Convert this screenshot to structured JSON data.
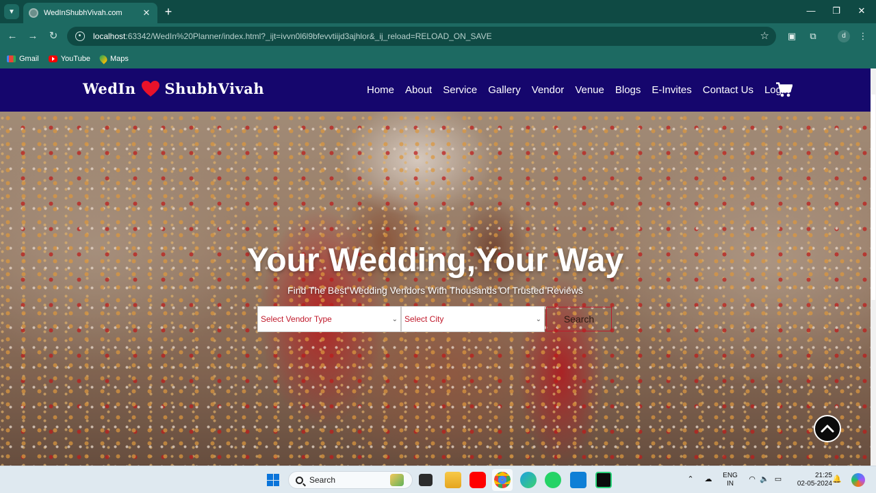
{
  "browser": {
    "tab": {
      "title": "WedInShubhVivah.com"
    },
    "url": {
      "host": "localhost",
      "rest": ":63342/WedIn%20Planner/index.html?_ijt=ivvn0l6l9bfevvtiijd3ajhlor&_ij_reload=RELOAD_ON_SAVE"
    },
    "profile_initial": "d",
    "bookmarks": [
      "Gmail",
      "YouTube",
      "Maps"
    ]
  },
  "site": {
    "logo_left": "WedIn",
    "logo_right": "ShubhVivah",
    "nav": [
      "Home",
      "About",
      "Service",
      "Gallery",
      "Vendor",
      "Venue",
      "Blogs",
      "E-Invites",
      "Contact Us",
      "Login"
    ],
    "hero": {
      "title": "Your Wedding,Your Way",
      "subtitle": "Find The Best Wedding Vendors With Thousands Of Trusted Reviews"
    },
    "search": {
      "vendor_type": "Select Vendor Type",
      "city": "Select City",
      "button": "Search"
    }
  },
  "taskbar": {
    "search_label": "Search",
    "language": "ENG",
    "region": "IN",
    "time": "21:25",
    "date": "02-05-2024"
  },
  "colors": {
    "nav_background": "#15066d",
    "heart": "#e8122a",
    "select_text": "#c0182a",
    "browser_chrome": "#1d6a62"
  }
}
